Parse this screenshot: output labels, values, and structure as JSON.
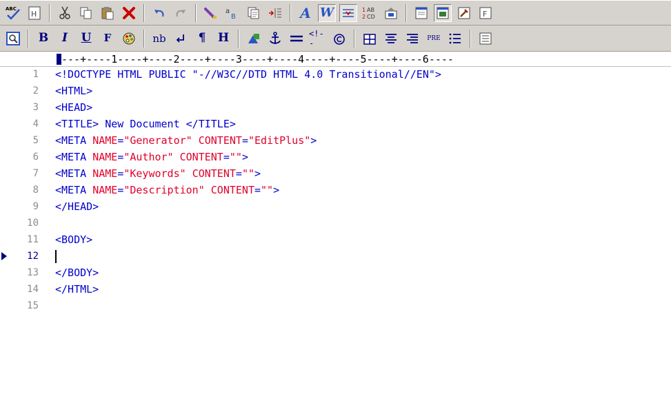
{
  "toolbar1": {
    "icons": [
      "spell-check-icon",
      "html-toolbar-icon",
      "cut-icon",
      "copy-icon",
      "paste-icon",
      "delete-icon",
      "undo-icon",
      "redo-icon",
      "find-icon",
      "replace-icon",
      "copy-document-icon",
      "indent-icon",
      "font-icon",
      "word-wrap-icon",
      "line-numbers-icon",
      "numbering-icon",
      "preferences-icon",
      "browser-view-icon",
      "output-window-icon",
      "tools-icon",
      "cliptext-icon"
    ]
  },
  "toolbar2": {
    "icons": [
      "preview-icon",
      "bold-icon",
      "italic-icon",
      "underline-icon",
      "font-face-icon",
      "color-icon",
      "nbsp-icon",
      "line-break-icon",
      "paragraph-icon",
      "heading-icon",
      "image-icon",
      "anchor-icon",
      "horizontal-rule-icon",
      "comment-icon",
      "copyright-icon",
      "table-icon",
      "center-align-icon",
      "right-align-icon",
      "pre-icon",
      "list-icon",
      "more-icon"
    ],
    "labels": {
      "bold": "B",
      "italic": "I",
      "underline": "U",
      "font": "F",
      "nbsp": "nb",
      "paragraph": "¶",
      "heading": "H",
      "pre": "PRE"
    }
  },
  "ruler": {
    "text": "---+----1----+----2----+----3----+----4----+----5----+----6----"
  },
  "editor": {
    "current_line": 12,
    "lines": [
      {
        "num": "1",
        "text": "<!DOCTYPE HTML PUBLIC \"-//W3C//DTD HTML 4.0 Transitional//EN\">"
      },
      {
        "num": "2",
        "text": "<HTML>"
      },
      {
        "num": "3",
        "text": "<HEAD>"
      },
      {
        "num": "4",
        "text": "<TITLE> New Document </TITLE>"
      },
      {
        "num": "5",
        "text": "<META NAME=\"Generator\" CONTENT=\"EditPlus\">"
      },
      {
        "num": "6",
        "text": "<META NAME=\"Author\" CONTENT=\"\">"
      },
      {
        "num": "7",
        "text": "<META NAME=\"Keywords\" CONTENT=\"\">"
      },
      {
        "num": "8",
        "text": "<META NAME=\"Description\" CONTENT=\"\">"
      },
      {
        "num": "9",
        "text": "</HEAD>"
      },
      {
        "num": "10",
        "text": ""
      },
      {
        "num": "11",
        "text": "<BODY>"
      },
      {
        "num": "12",
        "text": ""
      },
      {
        "num": "13",
        "text": "</BODY>"
      },
      {
        "num": "14",
        "text": "</HTML>"
      },
      {
        "num": "15",
        "text": ""
      }
    ]
  },
  "colors": {
    "tag": "#0000cc",
    "attribute": "#e0002a",
    "string": "#e0002a",
    "line_number": "#8c8c8c"
  }
}
